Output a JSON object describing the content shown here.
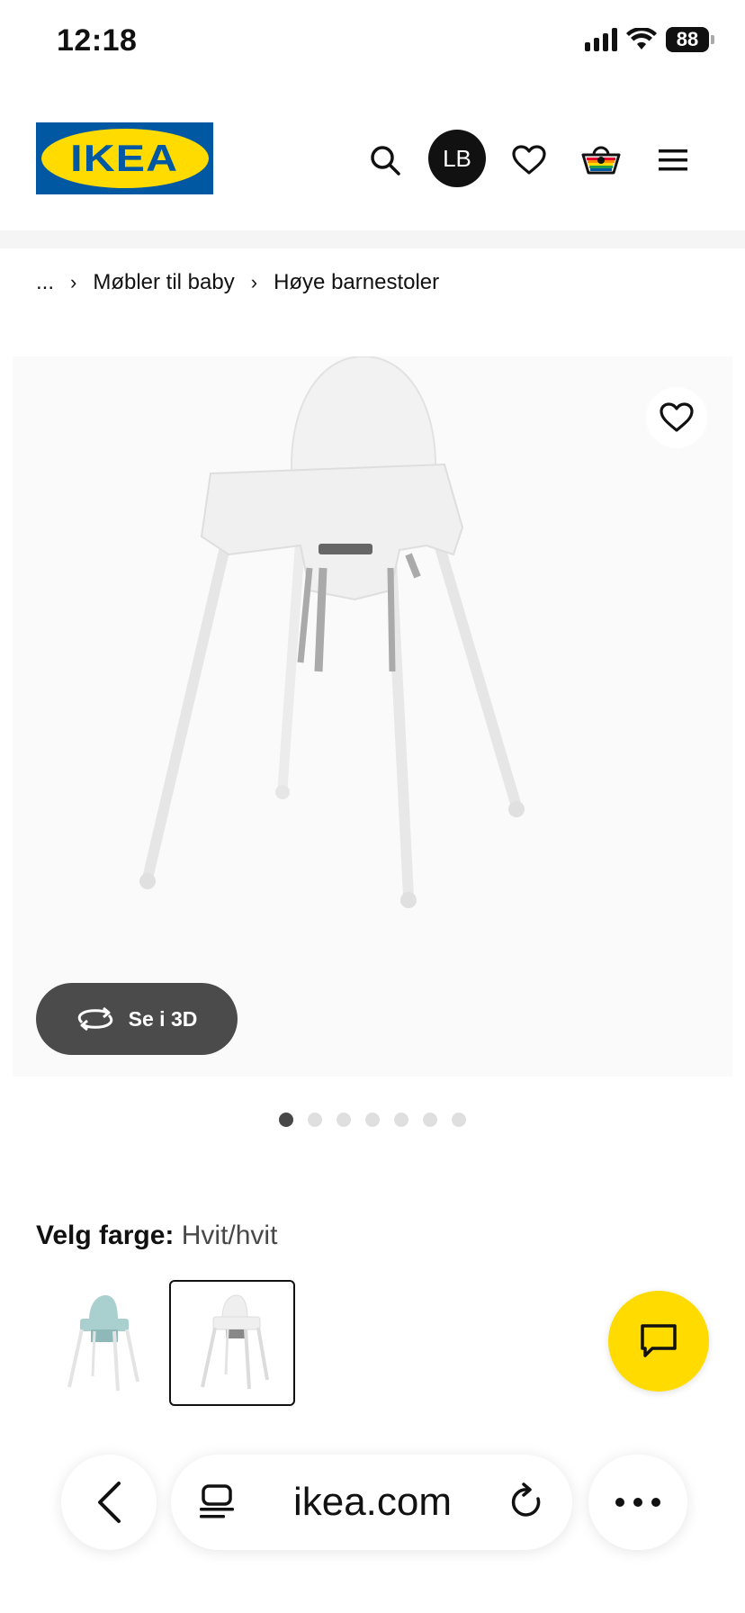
{
  "status_bar": {
    "time": "12:18",
    "battery": "88"
  },
  "header": {
    "logo_text": "IKEA",
    "avatar_initials": "LB"
  },
  "breadcrumb": {
    "ellipsis": "...",
    "items": [
      "Møbler til baby",
      "Høye barnestoler"
    ]
  },
  "product": {
    "see_3d_label": "Se i 3D",
    "image_count": 7,
    "active_image_index": 0
  },
  "color_select": {
    "label": "Velg farge:",
    "value": "Hvit/hvit"
  },
  "browser": {
    "url": "ikea.com"
  },
  "colors": {
    "ikea_blue": "#0058a3",
    "ikea_yellow": "#ffdb00",
    "chat_yellow": "#ffdb00"
  },
  "icons": [
    "search-icon",
    "heart-icon",
    "basket-icon",
    "menu-icon",
    "rotate-3d-icon",
    "chat-icon",
    "back-icon",
    "tabs-icon",
    "reload-icon",
    "more-icon"
  ]
}
